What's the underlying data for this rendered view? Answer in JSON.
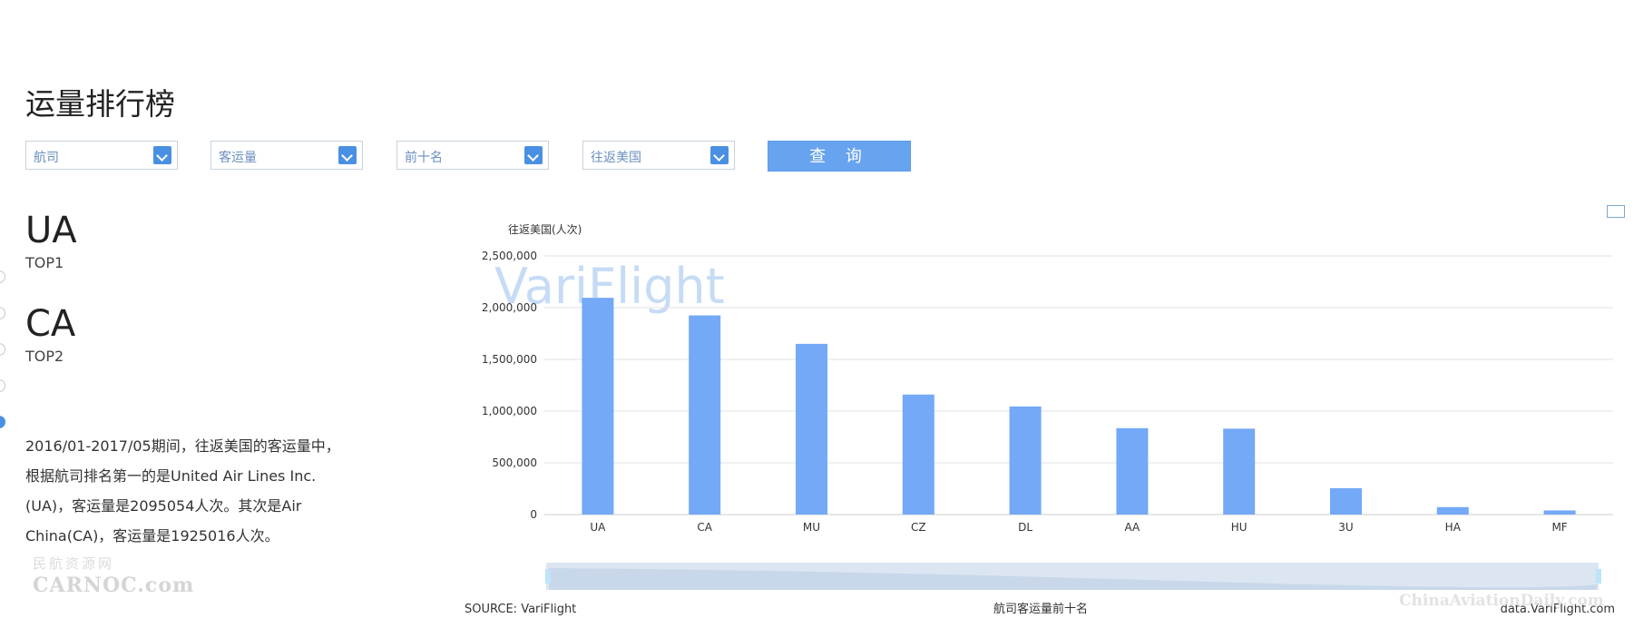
{
  "page": {
    "title": "运量排行榜"
  },
  "filters": {
    "items": [
      {
        "value": "航司"
      },
      {
        "value": "客运量"
      },
      {
        "value": "前十名"
      },
      {
        "value": "往返美国"
      }
    ],
    "query_label": "查 询"
  },
  "ranking": [
    {
      "code": "UA",
      "label": "TOP1"
    },
    {
      "code": "CA",
      "label": "TOP2"
    }
  ],
  "summary": {
    "lines": [
      "2016/01-2017/05期间，往返美国的客运量中，",
      "根据航司排名第一的是United Air Lines Inc.",
      "(UA)，客运量是2095054人次。其次是Air",
      "China(CA)，客运量是1925016人次。"
    ]
  },
  "watermarks": {
    "left_top": "民航资源网",
    "left_bottom": "CARNOC.com",
    "chart": "VariFlight",
    "right": "ChinaAviationDaily.com"
  },
  "footer": {
    "source": "SOURCE: VariFlight",
    "caption": "航司客运量前十名",
    "domain": "data.VariFlight.com"
  },
  "colors": {
    "bar": "#73a9f6",
    "accent": "#4a90e2",
    "grid": "#e3e3e3"
  },
  "chart_data": {
    "type": "bar",
    "ylabel": "往返美国(人次)",
    "categories": [
      "UA",
      "CA",
      "MU",
      "CZ",
      "DL",
      "AA",
      "HU",
      "3U",
      "HA",
      "MF"
    ],
    "values": [
      2095054,
      1925016,
      1650000,
      1160000,
      1045000,
      835000,
      830000,
      255000,
      72000,
      40000
    ],
    "ylim": [
      0,
      2500000
    ],
    "yticks": [
      0,
      500000,
      1000000,
      1500000,
      2000000,
      2500000
    ],
    "ytick_labels": [
      "0",
      "500,000",
      "1,000,000",
      "1,500,000",
      "2,000,000",
      "2,500,000"
    ],
    "grid": true,
    "legend": "none"
  }
}
